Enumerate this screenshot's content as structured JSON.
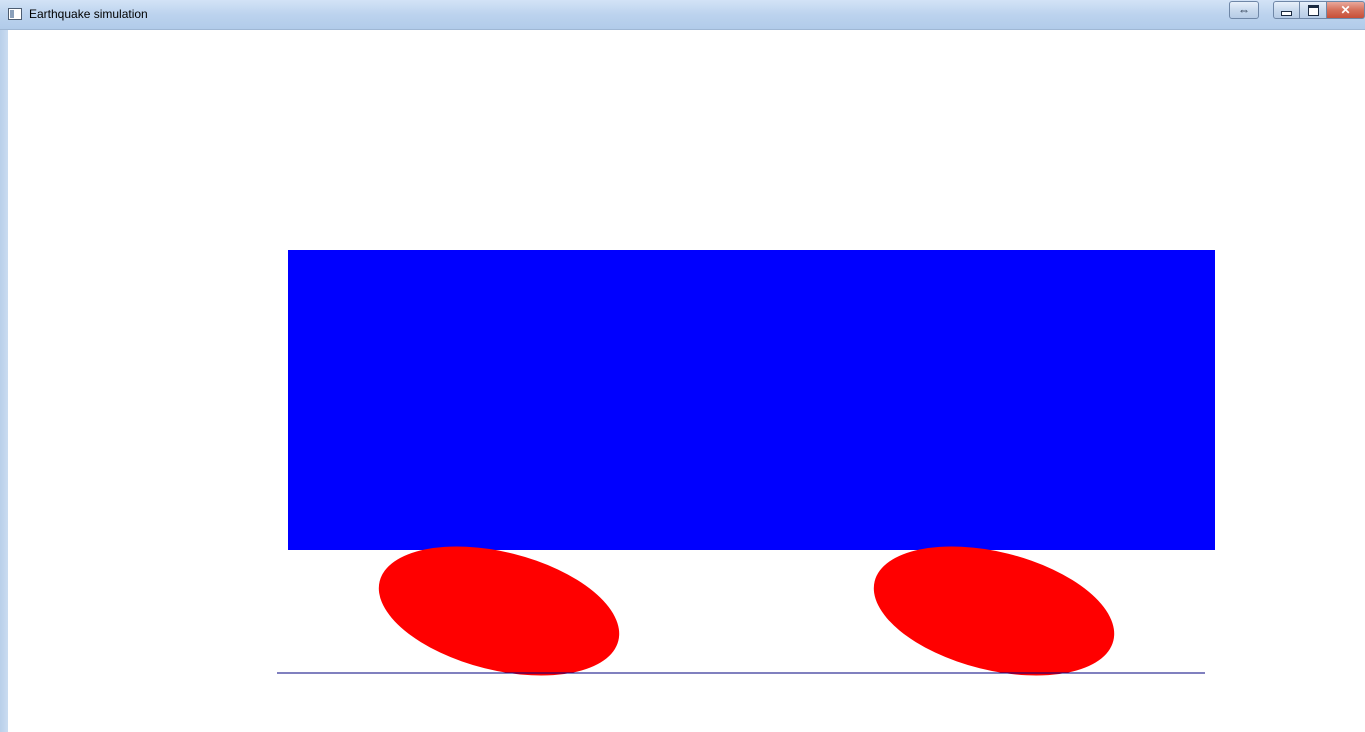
{
  "window": {
    "title": "Earthquake simulation",
    "icon": "console-window-icon",
    "controls": {
      "swap_icon": "swap-arrows-icon",
      "minimize_icon": "minimize-icon",
      "maximize_icon": "maximize-icon",
      "close_label": "✕"
    }
  },
  "scene": {
    "building_color": "#0000ff",
    "bearing_color": "#ff0000",
    "ground_line_color": "#00007f",
    "background_color": "#ffffff"
  }
}
